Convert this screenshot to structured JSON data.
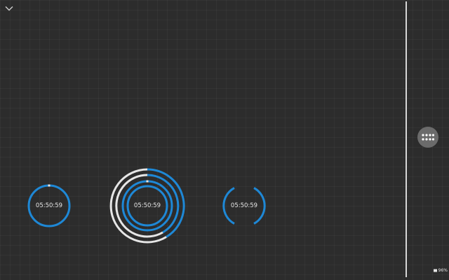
{
  "timers": [
    {
      "time": "05:50:59"
    },
    {
      "time": "05:50:59"
    },
    {
      "time": "05:50:59"
    }
  ],
  "status_bar": {
    "battery_text": "96%"
  },
  "colors": {
    "background": "#2c2c2c",
    "ring_blue": "#1e88d6",
    "ring_white": "#e6e6e6",
    "divider": "#d6d6d6",
    "fab": "#6b6b6b"
  },
  "icons": {
    "collapse": "chevron-down-icon",
    "menu": "dots-grid-icon",
    "battery": "battery-icon"
  }
}
